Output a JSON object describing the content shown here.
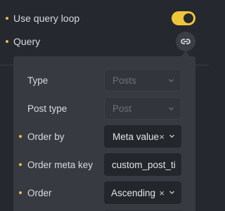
{
  "settings": {
    "use_query_loop": {
      "label": "Use query loop",
      "enabled": true
    },
    "query": {
      "label": "Query"
    }
  },
  "icons": {
    "query_button": "link-icon",
    "chevron": "chevron-down-icon",
    "clear": "clear-x-icon"
  },
  "panel": {
    "type": {
      "label": "Type",
      "value": "Posts"
    },
    "post_type": {
      "label": "Post type",
      "value": "Post"
    },
    "order_by": {
      "label": "Order by",
      "value": "Meta value",
      "clear": "×"
    },
    "order_meta_key": {
      "label": "Order meta key",
      "value": "custom_post_ti"
    },
    "order": {
      "label": "Order",
      "value": "Ascending",
      "clear": "×"
    }
  },
  "colors": {
    "accent": "#f0c53a",
    "background": "#25282e",
    "panel": "#373a40",
    "field": "#23262b"
  }
}
